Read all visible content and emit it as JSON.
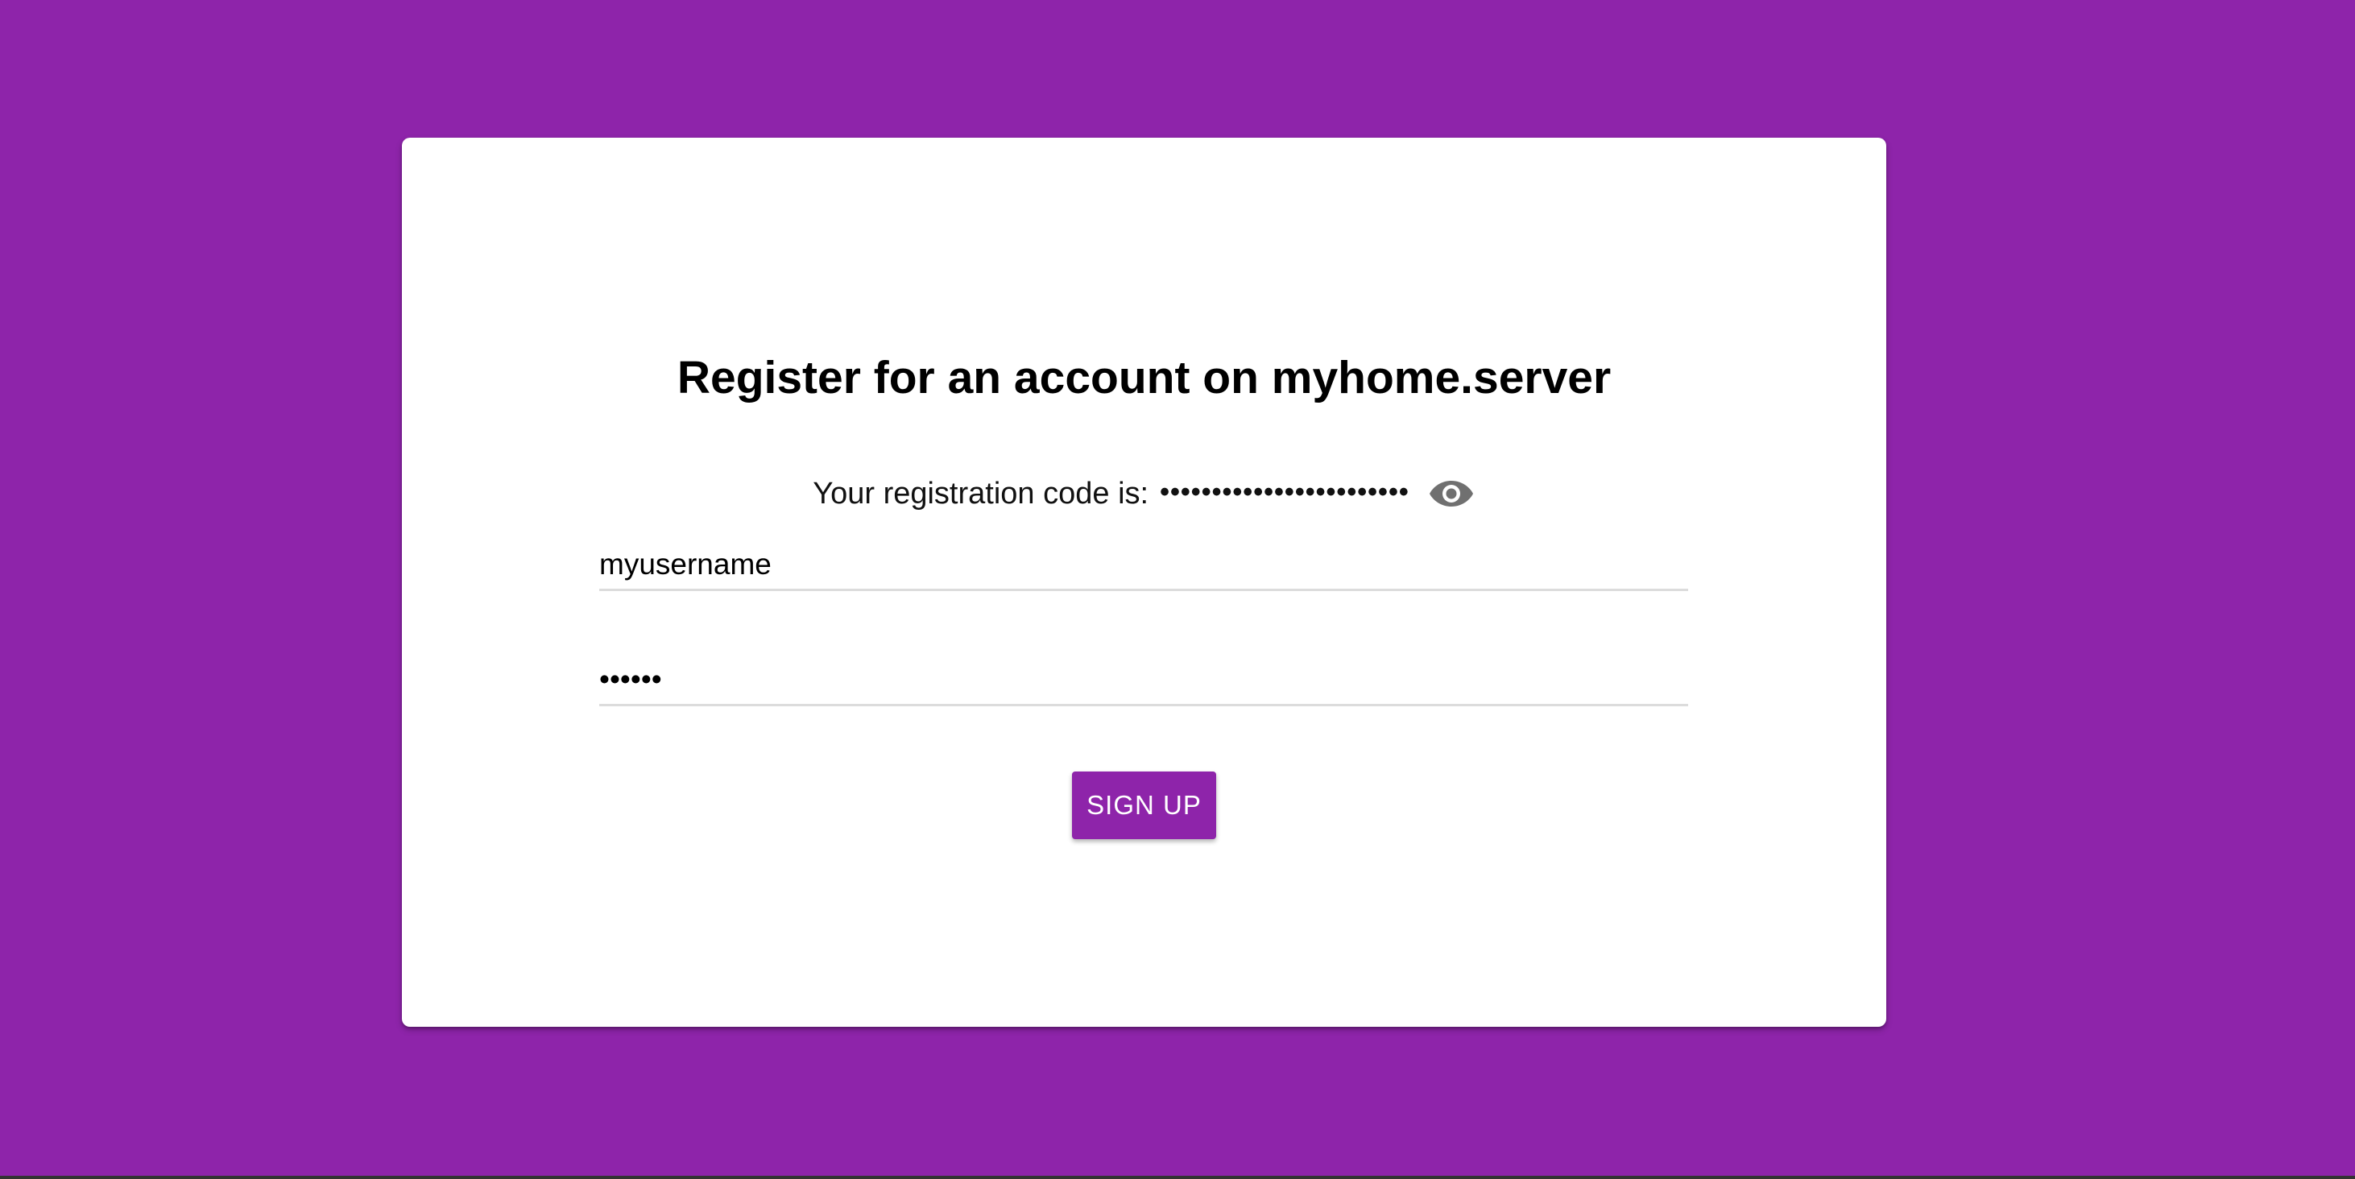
{
  "colors": {
    "background": "#8e24aa",
    "card": "#ffffff",
    "button": "#8e24aa",
    "icon": "#707070"
  },
  "form": {
    "title": "Register for an account on myhome.server",
    "code_label": "Your registration code is:",
    "code_masked": "••••••••••••••••••••••••",
    "show_code_icon": "eye-icon",
    "username_value": "myusername",
    "password_value": "••••••",
    "signup_label": "SIGN UP"
  }
}
